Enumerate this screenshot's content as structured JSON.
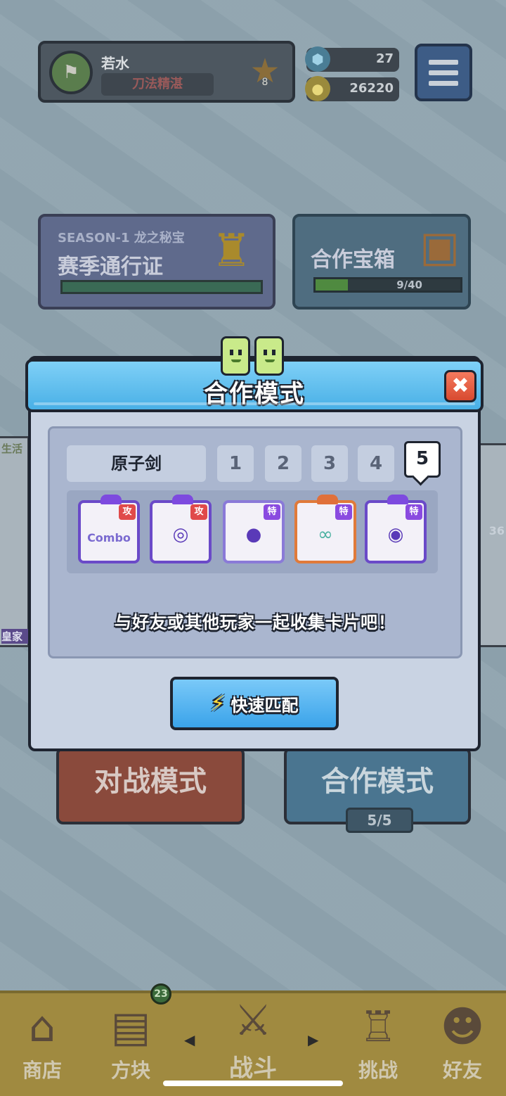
{
  "profile": {
    "name": "若水",
    "title": "刀法精湛",
    "rank_level": "8"
  },
  "currency": {
    "gems": "27",
    "coins": "26220"
  },
  "season": {
    "line1": "SEASON-1 龙之秘宝",
    "line2": "赛季通行证"
  },
  "coop_chest": {
    "label": "合作宝箱",
    "progress_text": "9/40",
    "progress_fraction": 0.225
  },
  "side": {
    "left_top": "生活",
    "left_bottom": "皇家",
    "right_value": "36"
  },
  "modes": {
    "pvp": "对战模式",
    "coop": "合作模式",
    "coop_count": "5/5"
  },
  "modal": {
    "title": "合作模式",
    "close_symbol": "✖",
    "deck_name": "原子剑",
    "deck_tabs": [
      "1",
      "2",
      "3",
      "4",
      "5"
    ],
    "active_deck": "5",
    "cards": [
      {
        "tag": "攻",
        "type": "attack",
        "content": "Combo"
      },
      {
        "tag": "攻",
        "type": "attack",
        "content": "◎"
      },
      {
        "tag": "特",
        "type": "special",
        "content": "●"
      },
      {
        "tag": "特",
        "type": "special",
        "content": "∞"
      },
      {
        "tag": "特",
        "type": "special",
        "content": "◉"
      }
    ],
    "info": "与好友或其他玩家一起收集卡片吧！",
    "quick_match": "快速匹配"
  },
  "nav": {
    "shop": "商店",
    "blocks": "方块",
    "blocks_badge": "23",
    "battle": "战斗",
    "challenge": "挑战",
    "friends": "好友"
  },
  "colors": {
    "modal_header": "#49b0e6",
    "close_button": "#d84a30",
    "accent_purple": "#6a4ac8"
  }
}
